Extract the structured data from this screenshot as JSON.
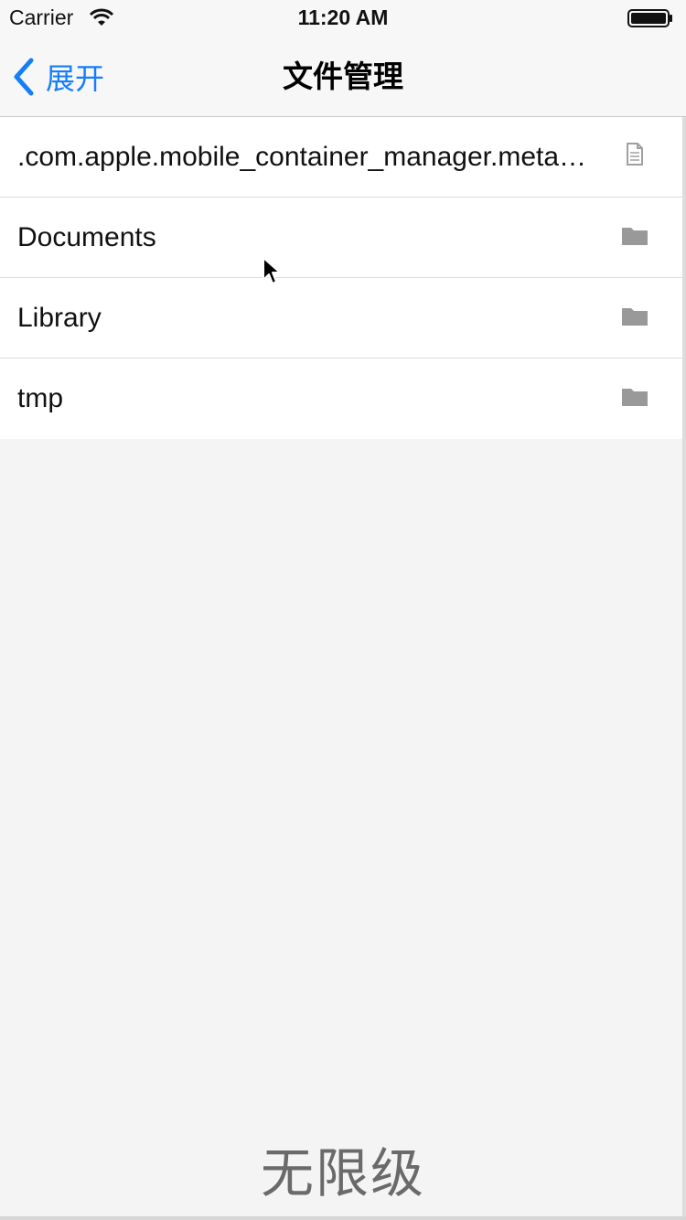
{
  "status_bar": {
    "carrier": "Carrier",
    "time": "11:20 AM",
    "wifi_icon": "wifi-icon",
    "battery_icon": "battery-icon"
  },
  "nav": {
    "back_label": "展开",
    "back_icon": "chevron-left-icon",
    "title": "文件管理",
    "accent_color": "#147efb"
  },
  "files": [
    {
      "name": ".com.apple.mobile_container_manager.metadata.plist",
      "type": "file",
      "icon": "file-icon"
    },
    {
      "name": "Documents",
      "type": "folder",
      "icon": "folder-icon"
    },
    {
      "name": "Library",
      "type": "folder",
      "icon": "folder-icon"
    },
    {
      "name": "tmp",
      "type": "folder",
      "icon": "folder-icon"
    }
  ],
  "watermark": "无限级"
}
